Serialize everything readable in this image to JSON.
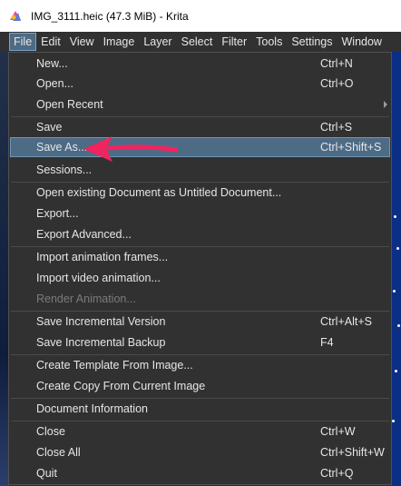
{
  "window": {
    "title": "IMG_3111.heic (47.3 MiB)  - Krita",
    "app_icon": "krita-icon"
  },
  "menubar": [
    {
      "label": "File",
      "active": true
    },
    {
      "label": "Edit"
    },
    {
      "label": "View"
    },
    {
      "label": "Image"
    },
    {
      "label": "Layer"
    },
    {
      "label": "Select"
    },
    {
      "label": "Filter"
    },
    {
      "label": "Tools"
    },
    {
      "label": "Settings"
    },
    {
      "label": "Window"
    }
  ],
  "file_menu": {
    "new": {
      "label": "New...",
      "shortcut": "Ctrl+N"
    },
    "open": {
      "label": "Open...",
      "shortcut": "Ctrl+O"
    },
    "open_recent": {
      "label": "Open Recent"
    },
    "save": {
      "label": "Save",
      "shortcut": "Ctrl+S"
    },
    "save_as": {
      "label": "Save As...",
      "shortcut": "Ctrl+Shift+S",
      "highlighted": true
    },
    "sessions": {
      "label": "Sessions..."
    },
    "open_existing_untitled": {
      "label": "Open existing Document as Untitled Document..."
    },
    "export": {
      "label": "Export..."
    },
    "export_advanced": {
      "label": "Export Advanced..."
    },
    "import_animation_frames": {
      "label": "Import animation frames..."
    },
    "import_video_animation": {
      "label": "Import video animation..."
    },
    "render_animation": {
      "label": "Render Animation...",
      "disabled": true
    },
    "save_incremental_version": {
      "label": "Save Incremental Version",
      "shortcut": "Ctrl+Alt+S"
    },
    "save_incremental_backup": {
      "label": "Save Incremental Backup",
      "shortcut": "F4"
    },
    "create_template": {
      "label": "Create Template From Image..."
    },
    "create_copy": {
      "label": "Create Copy From Current Image"
    },
    "document_information": {
      "label": "Document Information"
    },
    "close": {
      "label": "Close",
      "shortcut": "Ctrl+W"
    },
    "close_all": {
      "label": "Close All",
      "shortcut": "Ctrl+Shift+W"
    },
    "quit": {
      "label": "Quit",
      "shortcut": "Ctrl+Q"
    }
  },
  "colors": {
    "highlight": "#4d6b85",
    "annotation_arrow": "#f0245f",
    "menu_bg": "#313131"
  }
}
